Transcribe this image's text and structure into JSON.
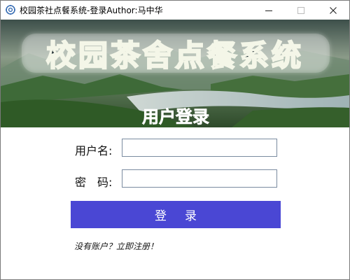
{
  "window": {
    "title": "校园茶社点餐系统-登录Author:马中华",
    "controls": {
      "minimize": "minimize",
      "maximize": "maximize",
      "close": "close"
    }
  },
  "banner": {
    "system_name": "校园茶舍点餐系统",
    "heading": "用户登录"
  },
  "form": {
    "username_label": "用户名:",
    "username_value": "",
    "password_label": "密　码:",
    "password_value": ""
  },
  "actions": {
    "login_label": "登录",
    "register_link": "没有账户？立即注册！"
  },
  "colors": {
    "login_button": "#4a47d4",
    "title_text": "#000000"
  }
}
